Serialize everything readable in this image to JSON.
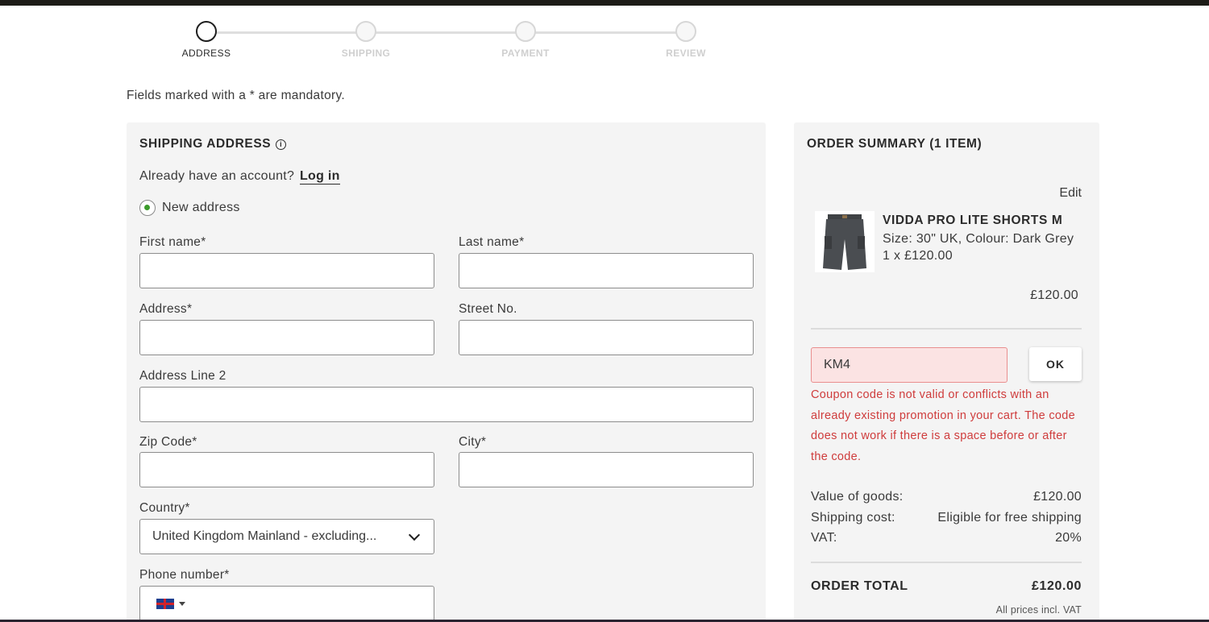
{
  "stepper": {
    "steps": [
      {
        "label": "ADDRESS",
        "active": true
      },
      {
        "label": "SHIPPING",
        "active": false
      },
      {
        "label": "PAYMENT",
        "active": false
      },
      {
        "label": "REVIEW",
        "active": false
      }
    ]
  },
  "form": {
    "mandatory_note": "Fields marked with a * are mandatory.",
    "section_title": "SHIPPING ADDRESS",
    "account_prompt": "Already have an account?",
    "login_link": "Log in",
    "address_option": "New address",
    "fields": {
      "first_name": {
        "label": "First name*",
        "value": ""
      },
      "last_name": {
        "label": "Last name*",
        "value": ""
      },
      "address": {
        "label": "Address*",
        "value": ""
      },
      "street_no": {
        "label": "Street No.",
        "value": ""
      },
      "address_line2": {
        "label": "Address Line 2",
        "value": ""
      },
      "zip_code": {
        "label": "Zip Code*",
        "value": ""
      },
      "city": {
        "label": "City*",
        "value": ""
      },
      "country": {
        "label": "Country*",
        "value": "United Kingdom Mainland - excluding..."
      },
      "phone": {
        "label": "Phone number*",
        "value": ""
      }
    }
  },
  "summary": {
    "title": "ORDER SUMMARY (1 ITEM)",
    "edit_label": "Edit",
    "product": {
      "name": "VIDDA PRO LITE SHORTS M",
      "size_colour": "Size:  30\" UK,  Colour:  Dark Grey",
      "qty_price": "1 x £120.00",
      "line_total": "£120.00"
    },
    "coupon": {
      "value": "KM4",
      "button": "OK",
      "error": "Coupon code is not valid or conflicts with an already existing promotion in your cart. The code does not work if there is a space before or after the code."
    },
    "totals": {
      "goods_label": "Value of goods:",
      "goods_value": "£120.00",
      "shipping_label": "Shipping cost:",
      "shipping_value": "Eligible for free shipping",
      "vat_label": "VAT:",
      "vat_value": "20%",
      "order_total_label": "ORDER TOTAL",
      "order_total_value": "£120.00",
      "vat_note": "All prices incl. VAT"
    }
  },
  "colors": {
    "accent_green": "#3b9b2a",
    "error_red": "#cf3c3c",
    "error_bg": "#fbe3e3"
  }
}
